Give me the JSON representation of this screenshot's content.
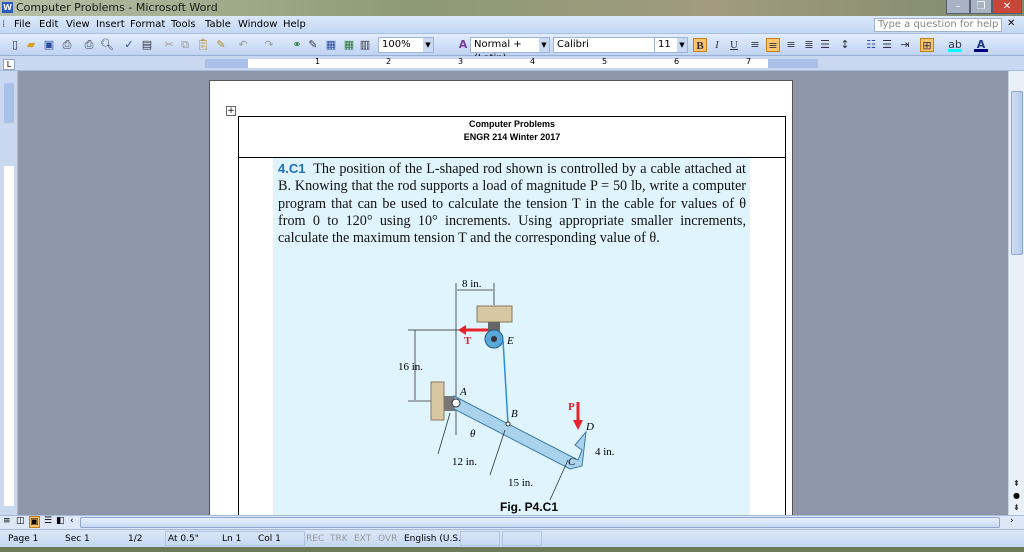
{
  "window": {
    "title": "Computer Problems - Microsoft Word",
    "controls": [
      "minimize",
      "restore",
      "close"
    ]
  },
  "menu": [
    "File",
    "Edit",
    "View",
    "Insert",
    "Format",
    "Tools",
    "Table",
    "Window",
    "Help"
  ],
  "help_placeholder": "Type a question for help",
  "toolbar": {
    "zoom": "100%",
    "style": "Normal + (Latin)",
    "font": "Calibri",
    "size": "11",
    "bold": "B",
    "italic": "I",
    "underline": "U"
  },
  "ruler": {
    "numbers": [
      "1",
      "2",
      "3",
      "4",
      "5",
      "6",
      "7"
    ]
  },
  "document": {
    "header_title": "Computer Problems",
    "header_subtitle": "ENGR 214 Winter 2017",
    "problem_number": "4.C1",
    "problem_text": "The position of the L-shaped rod shown is controlled by a cable attached at B. Knowing that the rod supports a load of magnitude P = 50 lb, write a computer program that can be used to calculate the tension T in the cable for values of θ from 0 to 120° using 10° increments. Using appropriate smaller increments, calculate the maximum tension T and the corresponding value of θ.",
    "figure": {
      "dim_8": "8 in.",
      "dim_16": "16 in.",
      "dim_12": "12 in.",
      "dim_15": "15 in.",
      "dim_4": "4 in.",
      "label_T": "T",
      "label_E": "E",
      "label_A": "A",
      "label_B": "B",
      "label_C": "C",
      "label_D": "D",
      "label_P": "P",
      "label_theta": "θ",
      "caption": "Fig. P4.C1"
    }
  },
  "status": {
    "page": "Page 1",
    "sec": "Sec 1",
    "pages": "1/2",
    "at": "At 0.5\"",
    "ln": "Ln 1",
    "col": "Col 1",
    "rec": "REC",
    "trk": "TRK",
    "ext": "EXT",
    "ovr": "OVR",
    "lang": "English (U.S."
  },
  "colors": {
    "accent": "#1d6fc4",
    "highlight": "#fbc46d",
    "problem_bg": "#dff4fd",
    "force": "#e8232a",
    "cable": "#2a8ee0"
  }
}
